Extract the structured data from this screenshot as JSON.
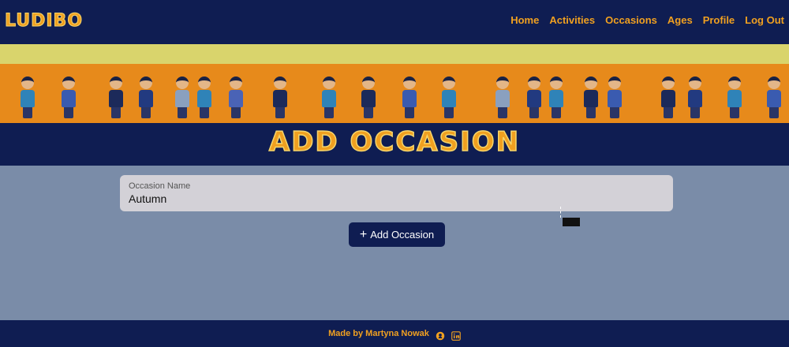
{
  "navbar": {
    "brand": "LUDIBO",
    "links": [
      "Home",
      "Activities",
      "Occasions",
      "Ages",
      "Profile",
      "Log Out"
    ]
  },
  "banner": {
    "colors": {
      "top": "#d9d46c",
      "main": "#e78a1b"
    }
  },
  "page": {
    "title": "ADD OCCASION"
  },
  "form": {
    "occasion_label": "Occasion Name",
    "occasion_value": "Autumn",
    "submit_label": "Add Occasion"
  },
  "footer": {
    "credit": "Made by Martyna Nowak",
    "icons": [
      "github-icon",
      "linkedin-icon"
    ]
  },
  "colors": {
    "nav_bg": "#0f1d52",
    "accent": "#f0a020",
    "page_bg": "#7a8ca8"
  }
}
